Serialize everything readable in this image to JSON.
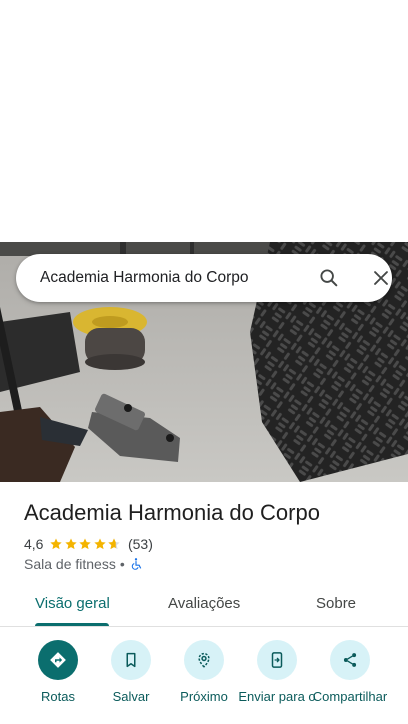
{
  "search": {
    "query": "Academia Harmonia do Corpo"
  },
  "place": {
    "title": "Academia Harmonia do Corpo",
    "rating": "4,6",
    "stars": 4.6,
    "review_count": "(53)",
    "category": "Sala de fitness",
    "separator": "•"
  },
  "tabs": [
    {
      "label": "Visão geral",
      "active": true
    },
    {
      "label": "Avaliações",
      "active": false
    },
    {
      "label": "Sobre",
      "active": false
    }
  ],
  "actions": [
    {
      "label": "Rotas",
      "icon": "directions-icon"
    },
    {
      "label": "Salvar",
      "icon": "bookmark-icon"
    },
    {
      "label": "Próximo",
      "icon": "nearby-icon"
    },
    {
      "label": "Enviar para o",
      "icon": "send-to-phone-icon"
    },
    {
      "label": "Compartilhar",
      "icon": "share-icon"
    }
  ],
  "colors": {
    "accent": "#0b6e6e",
    "action_bg": "#d7f2f7",
    "star": "#f4b400"
  }
}
